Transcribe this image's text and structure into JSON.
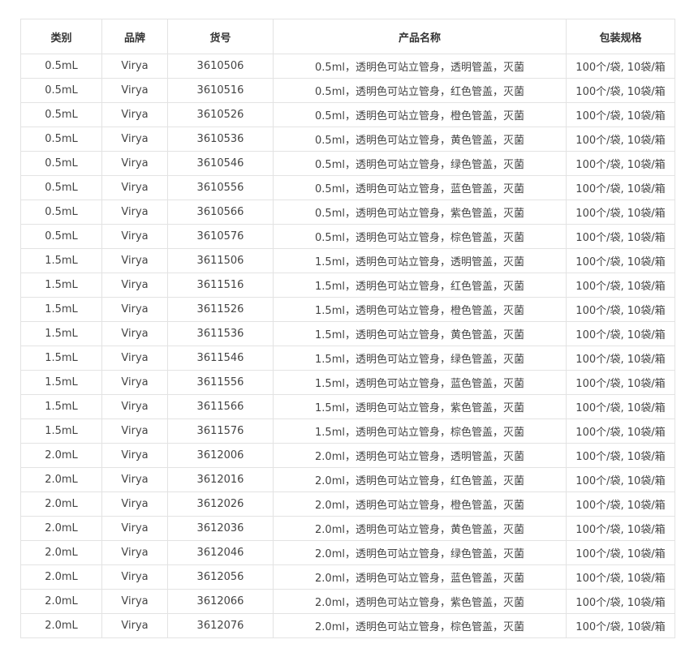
{
  "table": {
    "headers": {
      "category": "类别",
      "brand": "品牌",
      "sku": "货号",
      "name": "产品名称",
      "packaging": "包装规格"
    },
    "rows": [
      {
        "category": "0.5mL",
        "brand": "Virya",
        "sku": "3610506",
        "name": "0.5ml，透明色可站立管身，透明管盖，灭菌",
        "packaging": "100个/袋, 10袋/箱"
      },
      {
        "category": "0.5mL",
        "brand": "Virya",
        "sku": "3610516",
        "name": "0.5ml，透明色可站立管身，红色管盖，灭菌",
        "packaging": "100个/袋, 10袋/箱"
      },
      {
        "category": "0.5mL",
        "brand": "Virya",
        "sku": "3610526",
        "name": "0.5ml，透明色可站立管身，橙色管盖，灭菌",
        "packaging": "100个/袋, 10袋/箱"
      },
      {
        "category": "0.5mL",
        "brand": "Virya",
        "sku": "3610536",
        "name": "0.5ml，透明色可站立管身，黄色管盖，灭菌",
        "packaging": "100个/袋, 10袋/箱"
      },
      {
        "category": "0.5mL",
        "brand": "Virya",
        "sku": "3610546",
        "name": "0.5ml，透明色可站立管身，绿色管盖，灭菌",
        "packaging": "100个/袋, 10袋/箱"
      },
      {
        "category": "0.5mL",
        "brand": "Virya",
        "sku": "3610556",
        "name": "0.5ml，透明色可站立管身，蓝色管盖，灭菌",
        "packaging": "100个/袋, 10袋/箱"
      },
      {
        "category": "0.5mL",
        "brand": "Virya",
        "sku": "3610566",
        "name": "0.5ml，透明色可站立管身，紫色管盖，灭菌",
        "packaging": "100个/袋, 10袋/箱"
      },
      {
        "category": "0.5mL",
        "brand": "Virya",
        "sku": "3610576",
        "name": "0.5ml，透明色可站立管身，棕色管盖，灭菌",
        "packaging": "100个/袋, 10袋/箱"
      },
      {
        "category": "1.5mL",
        "brand": "Virya",
        "sku": "3611506",
        "name": "1.5ml，透明色可站立管身，透明管盖，灭菌",
        "packaging": "100个/袋, 10袋/箱"
      },
      {
        "category": "1.5mL",
        "brand": "Virya",
        "sku": "3611516",
        "name": "1.5ml，透明色可站立管身，红色管盖，灭菌",
        "packaging": "100个/袋, 10袋/箱"
      },
      {
        "category": "1.5mL",
        "brand": "Virya",
        "sku": "3611526",
        "name": "1.5ml，透明色可站立管身，橙色管盖，灭菌",
        "packaging": "100个/袋, 10袋/箱"
      },
      {
        "category": "1.5mL",
        "brand": "Virya",
        "sku": "3611536",
        "name": "1.5ml，透明色可站立管身，黄色管盖，灭菌",
        "packaging": "100个/袋, 10袋/箱"
      },
      {
        "category": "1.5mL",
        "brand": "Virya",
        "sku": "3611546",
        "name": "1.5ml，透明色可站立管身，绿色管盖，灭菌",
        "packaging": "100个/袋, 10袋/箱"
      },
      {
        "category": "1.5mL",
        "brand": "Virya",
        "sku": "3611556",
        "name": "1.5ml，透明色可站立管身，蓝色管盖，灭菌",
        "packaging": "100个/袋, 10袋/箱"
      },
      {
        "category": "1.5mL",
        "brand": "Virya",
        "sku": "3611566",
        "name": "1.5ml，透明色可站立管身，紫色管盖，灭菌",
        "packaging": "100个/袋, 10袋/箱"
      },
      {
        "category": "1.5mL",
        "brand": "Virya",
        "sku": "3611576",
        "name": "1.5ml，透明色可站立管身，棕色管盖，灭菌",
        "packaging": "100个/袋, 10袋/箱"
      },
      {
        "category": "2.0mL",
        "brand": "Virya",
        "sku": "3612006",
        "name": "2.0ml，透明色可站立管身，透明管盖，灭菌",
        "packaging": "100个/袋, 10袋/箱"
      },
      {
        "category": "2.0mL",
        "brand": "Virya",
        "sku": "3612016",
        "name": "2.0ml，透明色可站立管身，红色管盖，灭菌",
        "packaging": "100个/袋, 10袋/箱"
      },
      {
        "category": "2.0mL",
        "brand": "Virya",
        "sku": "3612026",
        "name": "2.0ml，透明色可站立管身，橙色管盖，灭菌",
        "packaging": "100个/袋, 10袋/箱"
      },
      {
        "category": "2.0mL",
        "brand": "Virya",
        "sku": "3612036",
        "name": "2.0ml，透明色可站立管身，黄色管盖，灭菌",
        "packaging": "100个/袋, 10袋/箱"
      },
      {
        "category": "2.0mL",
        "brand": "Virya",
        "sku": "3612046",
        "name": "2.0ml，透明色可站立管身，绿色管盖，灭菌",
        "packaging": "100个/袋, 10袋/箱"
      },
      {
        "category": "2.0mL",
        "brand": "Virya",
        "sku": "3612056",
        "name": "2.0ml，透明色可站立管身，蓝色管盖，灭菌",
        "packaging": "100个/袋, 10袋/箱"
      },
      {
        "category": "2.0mL",
        "brand": "Virya",
        "sku": "3612066",
        "name": "2.0ml，透明色可站立管身，紫色管盖，灭菌",
        "packaging": "100个/袋, 10袋/箱"
      },
      {
        "category": "2.0mL",
        "brand": "Virya",
        "sku": "3612076",
        "name": "2.0ml，透明色可站立管身，棕色管盖，灭菌",
        "packaging": "100个/袋, 10袋/箱"
      }
    ]
  }
}
